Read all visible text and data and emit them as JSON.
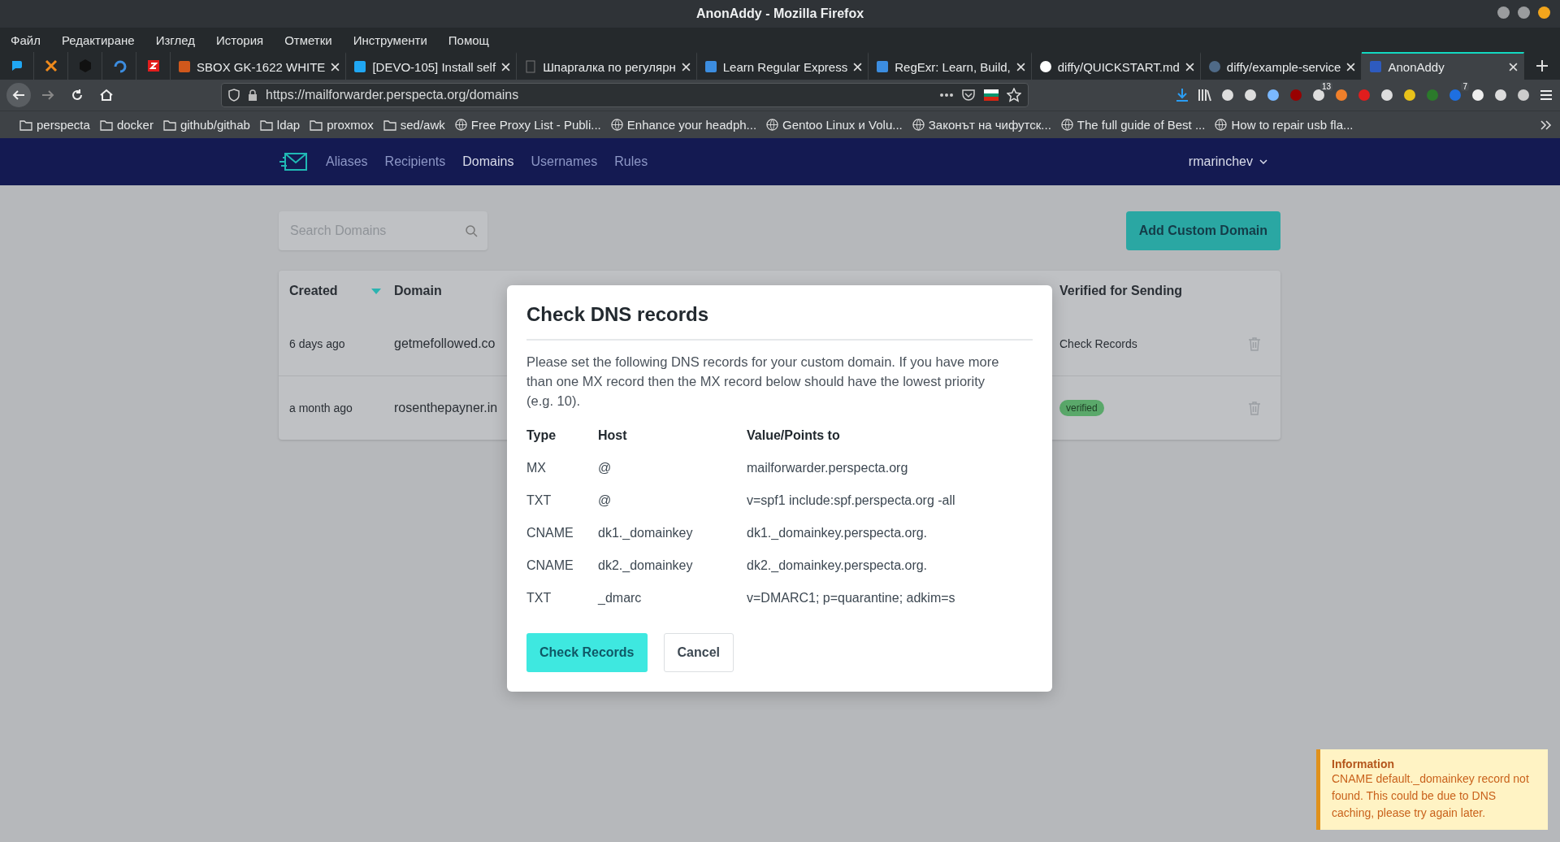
{
  "window": {
    "title": "AnonAddy - Mozilla Firefox"
  },
  "menu": [
    "Файл",
    "Редактиране",
    "Изглед",
    "История",
    "Отметки",
    "Инструменти",
    "Помощ"
  ],
  "tabs": [
    {
      "label": "SBOX GK-1622 WHITE",
      "selected": false
    },
    {
      "label": "[DEVO-105] Install self",
      "selected": false
    },
    {
      "label": "Шпаргалка по регулярн",
      "selected": false
    },
    {
      "label": "Learn Regular Express",
      "selected": false
    },
    {
      "label": "RegExr: Learn, Build,",
      "selected": false
    },
    {
      "label": "diffy/QUICKSTART.md",
      "selected": false
    },
    {
      "label": "diffy/example-service",
      "selected": false
    },
    {
      "label": "AnonAddy",
      "selected": true
    }
  ],
  "address": {
    "url": "https://mailforwarder.perspecta.org/domains"
  },
  "toolbar_badges": [
    "13",
    "7"
  ],
  "bookmarks": [
    {
      "kind": "folder",
      "label": "perspecta"
    },
    {
      "kind": "folder",
      "label": "docker"
    },
    {
      "kind": "folder",
      "label": "github/githab"
    },
    {
      "kind": "folder",
      "label": "ldap"
    },
    {
      "kind": "folder",
      "label": "proxmox"
    },
    {
      "kind": "folder",
      "label": "sed/awk"
    },
    {
      "kind": "site",
      "label": "Free Proxy List - Publi..."
    },
    {
      "kind": "site",
      "label": "Enhance your headph..."
    },
    {
      "kind": "site",
      "label": "Gentoo Linux и Volu..."
    },
    {
      "kind": "site",
      "label": "Законът на чифутск..."
    },
    {
      "kind": "site",
      "label": "The full guide of Best ..."
    },
    {
      "kind": "site",
      "label": "How to repair usb fla..."
    }
  ],
  "app_nav": {
    "items": [
      {
        "label": "Aliases",
        "selected": false
      },
      {
        "label": "Recipients",
        "selected": false
      },
      {
        "label": "Domains",
        "selected": true
      },
      {
        "label": "Usernames",
        "selected": false
      },
      {
        "label": "Rules",
        "selected": false
      }
    ],
    "user": "rmarinchev"
  },
  "search": {
    "placeholder": "Search Domains"
  },
  "add_button": "Add Custom Domain",
  "table": {
    "columns": [
      {
        "label": "Created",
        "sorted": true
      },
      {
        "label": "Domain",
        "sorted": false
      },
      {
        "label": "Verified for Sending",
        "sorted": false
      }
    ],
    "rows": [
      {
        "created": "6 days ago",
        "domain": "getmefollowed.co",
        "sending": {
          "kind": "text",
          "label": "Check Records"
        }
      },
      {
        "created": "a month ago",
        "domain": "rosenthepayner.in",
        "sending": {
          "kind": "badge",
          "label": "verified"
        }
      }
    ]
  },
  "modal": {
    "title": "Check DNS records",
    "text": "Please set the following DNS records for your custom domain. If you have more than one MX record then the MX record below should have the lowest priority (e.g. 10).",
    "columns": [
      "Type",
      "Host",
      "Value/Points to"
    ],
    "records": [
      {
        "type": "MX",
        "host": "@",
        "value": "mailforwarder.perspecta.org"
      },
      {
        "type": "TXT",
        "host": "@",
        "value": "v=spf1 include:spf.perspecta.org -all"
      },
      {
        "type": "CNAME",
        "host": "dk1._domainkey",
        "value": "dk1._domainkey.perspecta.org."
      },
      {
        "type": "CNAME",
        "host": "dk2._domainkey",
        "value": "dk2._domainkey.perspecta.org."
      },
      {
        "type": "TXT",
        "host": "_dmarc",
        "value": "v=DMARC1; p=quarantine; adkim=s"
      }
    ],
    "buttons": [
      {
        "label": "Check Records",
        "kind": "primary"
      },
      {
        "label": "Cancel",
        "kind": "secondary"
      }
    ]
  },
  "notification": {
    "title": "Information",
    "message": "CNAME default._domainkey record not found. This could be due to DNS caching, please try again later."
  }
}
